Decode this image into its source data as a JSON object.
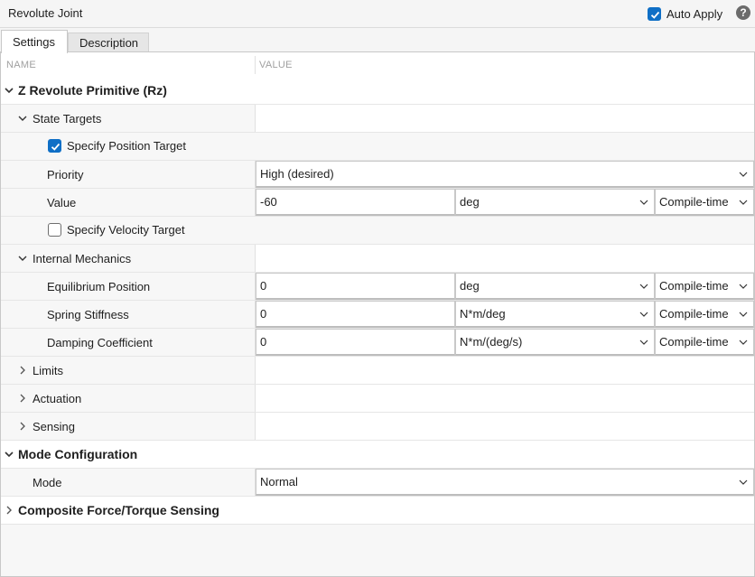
{
  "window": {
    "title": "Revolute Joint",
    "auto_apply_label": "Auto Apply",
    "auto_apply_checked": true
  },
  "tabs": [
    "Settings",
    "Description"
  ],
  "columns": {
    "name": "NAME",
    "value": "VALUE"
  },
  "sections": {
    "rz": "Z Revolute Primitive (Rz)",
    "state_targets": "State Targets",
    "specify_position": "Specify Position Target",
    "priority": {
      "label": "Priority",
      "value": "High (desired)"
    },
    "value": {
      "label": "Value",
      "value": "-60",
      "unit": "deg",
      "eval": "Compile-time"
    },
    "specify_velocity": "Specify Velocity Target",
    "internal_mechanics": "Internal Mechanics",
    "equilibrium": {
      "label": "Equilibrium Position",
      "value": "0",
      "unit": "deg",
      "eval": "Compile-time"
    },
    "spring": {
      "label": "Spring Stiffness",
      "value": "0",
      "unit": "N*m/deg",
      "eval": "Compile-time"
    },
    "damping": {
      "label": "Damping Coefficient",
      "value": "0",
      "unit": "N*m/(deg/s)",
      "eval": "Compile-time"
    },
    "limits": "Limits",
    "actuation": "Actuation",
    "sensing": "Sensing",
    "mode_config": "Mode Configuration",
    "mode": {
      "label": "Mode",
      "value": "Normal"
    },
    "composite": "Composite Force/Torque Sensing"
  },
  "colors": {
    "accent": "#0f6fc6",
    "text": "#1e1e1e",
    "header_text": "#a0a0a0"
  }
}
